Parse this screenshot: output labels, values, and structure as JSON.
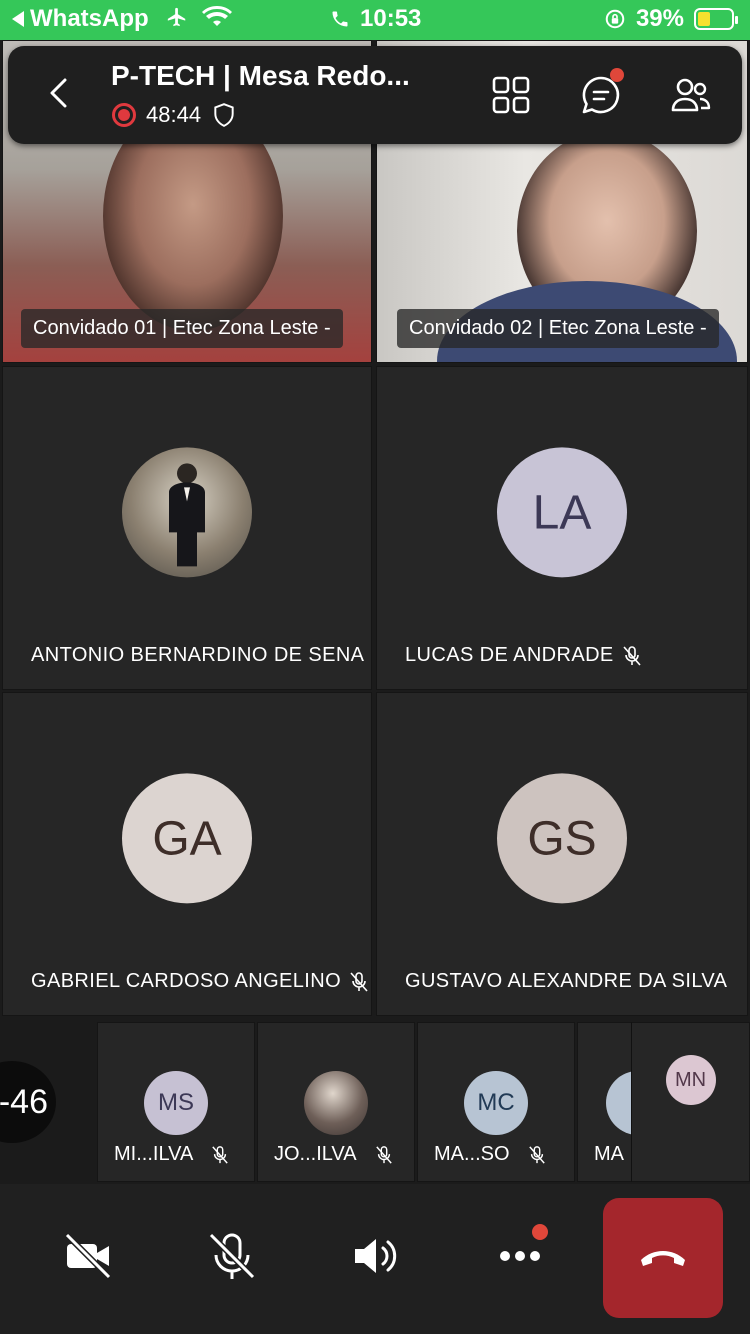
{
  "status_bar": {
    "back_app": "WhatsApp",
    "time": "10:53",
    "battery": "39%",
    "battery_level": 0.39
  },
  "call_header": {
    "title": "P-TECH | Mesa Redo...",
    "recording_time": "48:44"
  },
  "video_tiles": [
    {
      "label": "Convidado 01 | Etec Zona Leste -"
    },
    {
      "label": "Convidado 02 | Etec Zona Leste -"
    }
  ],
  "participants": [
    {
      "name": "ANTONIO BERNARDINO DE SENA",
      "avatar_type": "photo",
      "initials": ""
    },
    {
      "name": "LUCAS DE ANDRADE",
      "initials": "LA",
      "avatar_bg": "#c8c4d6",
      "avatar_fg": "#3c3856",
      "muted": true
    },
    {
      "name": "GABRIEL CARDOSO ANGELINO",
      "initials": "GA",
      "avatar_bg": "#dcd4d0",
      "avatar_fg": "#3e2e29",
      "muted": true
    },
    {
      "name": "GUSTAVO ALEXANDRE DA SILVA",
      "initials": "GS",
      "avatar_bg": "#cdc3bf",
      "avatar_fg": "#3e2e29"
    }
  ],
  "strip": {
    "more_count": "-46",
    "tiles": [
      {
        "name": "MI...ILVA",
        "initials": "MS",
        "avatar_bg": "#c6c1d3",
        "avatar_fg": "#3c3856"
      },
      {
        "name": "JO...ILVA",
        "initials": "",
        "avatar_type": "photo"
      },
      {
        "name": "MA...SO",
        "initials": "MC",
        "avatar_bg": "#b7c4d3",
        "avatar_fg": "#213a55"
      },
      {
        "name": "MA",
        "initials": ""
      },
      {
        "name": "",
        "initials": "MN",
        "avatar_bg": "#dcc7d2",
        "avatar_fg": "#52384a"
      }
    ]
  },
  "toolbar": {
    "camera_icon": "camera-off-icon",
    "mic_icon": "mic-off-icon",
    "speaker_icon": "speaker-icon",
    "more_icon": "more-icon",
    "hangup_icon": "hang-up-icon",
    "hangup_color": "#a4262c"
  }
}
